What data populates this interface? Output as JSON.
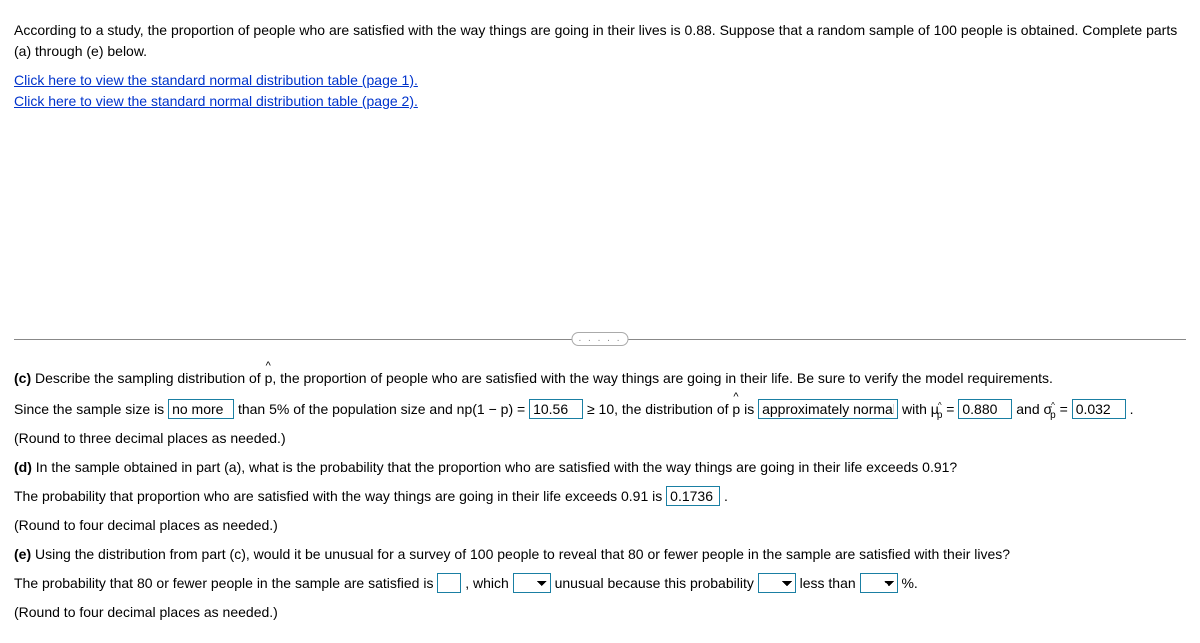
{
  "header": {
    "problem_statement": "According to a study, the proportion of people who are satisfied with the way things are going in their lives is 0.88. Suppose that a random sample of 100 people is obtained. Complete parts (a) through (e) below.",
    "link1": "Click here to view the standard normal distribution table (page 1).",
    "link2": "Click here to view the standard normal distribution table (page 2)."
  },
  "divider_handle": ". . . . .",
  "part_c": {
    "label": "(c)",
    "prompt": "Describe the sampling distribution of ",
    "prompt_after_phat": ", the proportion of people who are satisfied with the way things are going in their life. Be sure to verify the model requirements.",
    "line_before_select1": "Since the sample size is ",
    "select1_value": "no more",
    "line_mid1": " than 5% of the population size and np(1 − p) = ",
    "np_value": "10.56",
    "line_mid2": " ≥ 10, the distribution of ",
    "line_mid3": " is ",
    "select2_value": "approximately normal",
    "line_mid4": " with μ",
    "eq": " = ",
    "mu_value": "0.880",
    "line_mid5": " and σ",
    "sigma_value": "0.032",
    "period": ".",
    "round_note": "(Round to three decimal places as needed.)"
  },
  "part_d": {
    "label": "(d)",
    "prompt": "In the sample obtained in part (a), what is the probability that the proportion who are satisfied with the way things are going in their life exceeds 0.91?",
    "answer_line_before": "The probability that proportion who are satisfied with the way things are going in their life exceeds 0.91 is ",
    "prob_value": "0.1736",
    "round_note": "(Round to four decimal places as needed.)"
  },
  "part_e": {
    "label": "(e)",
    "prompt": "Using the distribution from part (c), would it be unusual for a survey of 100 people to reveal that 80 or fewer people in the sample are satisfied with their lives?",
    "answer_before": "The probability that 80 or fewer people in the sample are satisfied is ",
    "after_input": ", which ",
    "after_sel1": " unusual because this probability ",
    "after_sel2": " less than ",
    "after_sel3": " %.",
    "round_note": "(Round to four decimal places as needed.)"
  }
}
